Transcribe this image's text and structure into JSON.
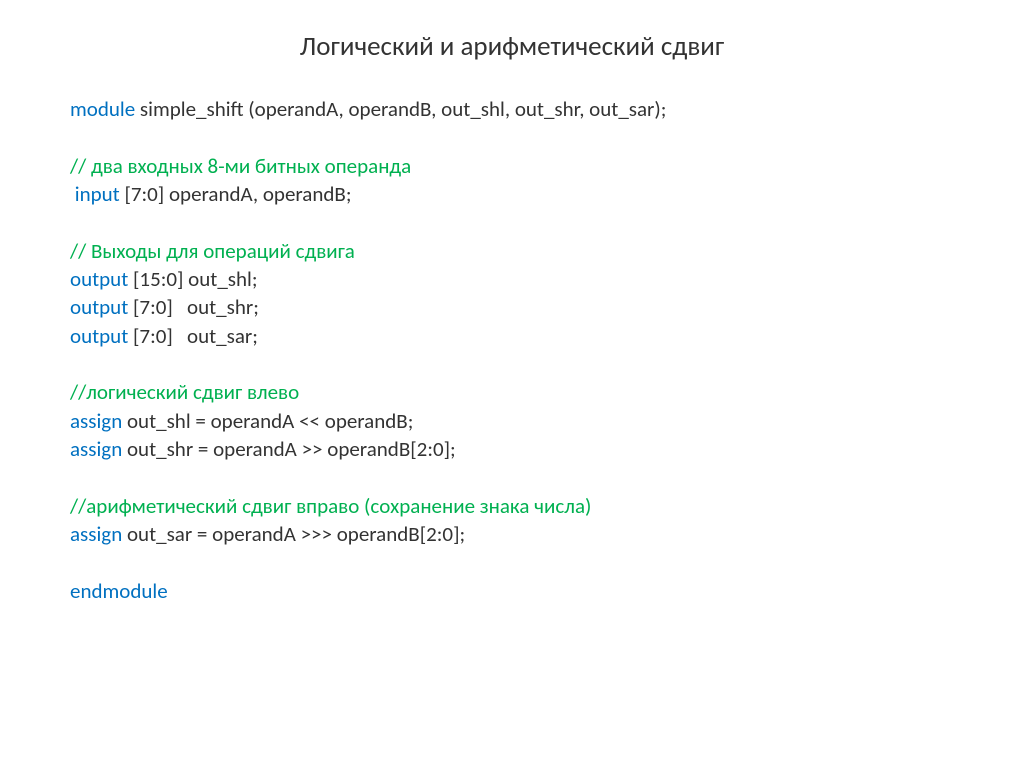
{
  "title": "Логический и арифметический сдвиг",
  "code": {
    "l1_kw": "module",
    "l1_txt": " simple_shift (operandA, operandB, out_shl, out_shr, out_sar);",
    "l2_cm": "// два входных 8-ми битных операнда",
    "l3_kw": " input",
    "l3_txt": " [7:0] operandA, operandB;",
    "l4_cm": "// Выходы для операций сдвига",
    "l5_kw": "output",
    "l5_txt": " [15:0] out_shl;",
    "l6_kw": "output",
    "l6_txt": " [7:0]   out_shr;",
    "l7_kw": "output",
    "l7_txt": " [7:0]   out_sar;",
    "l8_cm": "//логический сдвиг влево",
    "l9_kw": "assign",
    "l9_txt": " out_shl = operandA << operandB;",
    "l10_kw": "assign",
    "l10_txt": " out_shr = operandA >> operandB[2:0];",
    "l11_cm": "//арифметический сдвиг вправо (сохранение знака числа)",
    "l12_kw": "assign",
    "l12_txt": " out_sar = operandA >>> operandB[2:0];",
    "l13_kw": "endmodule"
  }
}
